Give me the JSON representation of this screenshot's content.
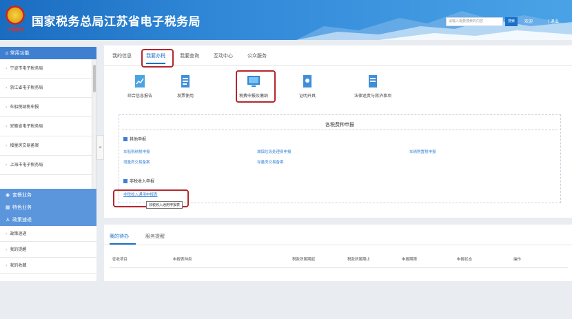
{
  "header": {
    "title": "国家税务总局江苏省电子税务局",
    "emblem_text": "中国税务",
    "search_placeholder": "请输入需要搜索的内容",
    "search_btn": "搜索",
    "welcome": "欢迎",
    "logout": "| 退出"
  },
  "sidebar": {
    "head": "常用功能",
    "items": [
      "宁波市电子税务局",
      "浙江省电子税务局",
      "车船税纳税申报",
      "安徽省电子税务局",
      "增量房交易备案",
      "上海市电子税务局"
    ],
    "blue_items": [
      "套餐业务",
      "特色业务",
      "政策速递"
    ],
    "lower_items": [
      "政策速递",
      "我的提醒",
      "我的收藏"
    ]
  },
  "tabs": [
    "我的信息",
    "我要办税",
    "我要查询",
    "互动中心",
    "公众服务"
  ],
  "tools": [
    "综合信息报告",
    "发票使用",
    "税费申报及缴纳",
    "证明开具",
    "法律追责与救济事项"
  ],
  "panel": {
    "title": "各税费种申报",
    "group1": "其他申报",
    "links1": [
      "车船税纳税申报",
      "增量房交易备案",
      "城镇垃圾处理费申报",
      "存量房交易备案",
      "车辆购置税申报"
    ],
    "group2": "非税收入申报",
    "link2": "非税收入通用申报表",
    "tooltip": "非税收入通用申报表"
  },
  "lower": {
    "tabs": [
      "我的待办",
      "服务提醒"
    ],
    "headers": [
      "征收项目",
      "申报表种类",
      "税款所属期起",
      "税款所属期止",
      "申报期限",
      "申报状态",
      "操作"
    ]
  }
}
